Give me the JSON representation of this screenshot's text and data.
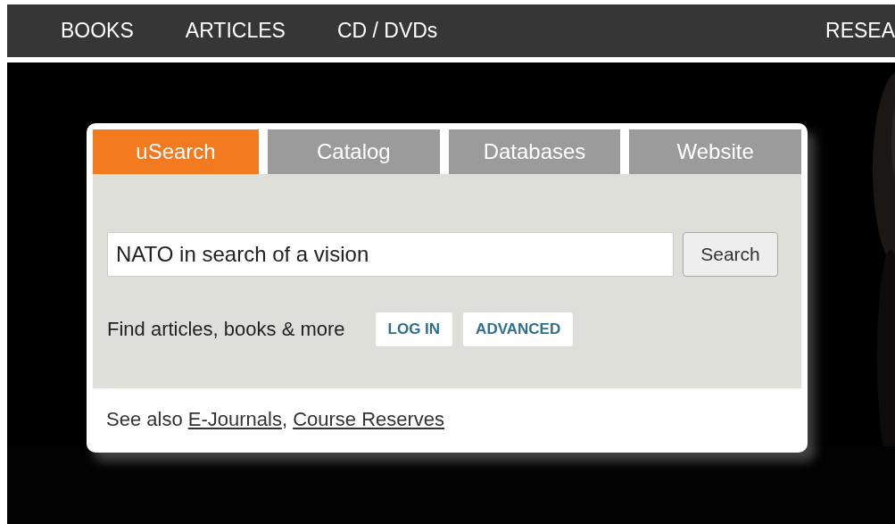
{
  "nav": {
    "items": [
      {
        "label": "BOOKS"
      },
      {
        "label": "ARTICLES"
      },
      {
        "label": "CD / DVDs"
      },
      {
        "label": "RESEA"
      }
    ]
  },
  "search_box": {
    "tabs": [
      {
        "label": "uSearch",
        "selected": true
      },
      {
        "label": "Catalog",
        "selected": false
      },
      {
        "label": "Databases",
        "selected": false
      },
      {
        "label": "Website",
        "selected": false
      }
    ],
    "query": "NATO in search of a vision",
    "search_button": "Search",
    "hint": "Find articles, books & more",
    "buttons": [
      "LOG IN",
      "ADVANCED"
    ],
    "see_also": {
      "prefix": "See also",
      "separator": ",",
      "links": [
        {
          "label": "E-Journals"
        },
        {
          "label": "Course Reserves"
        }
      ]
    }
  }
}
